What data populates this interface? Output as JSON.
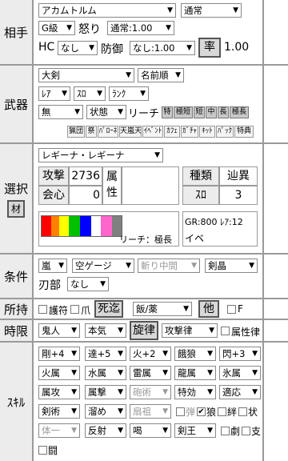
{
  "aite": {
    "label": "相手",
    "monster": "アカムトルム",
    "mode": "通常",
    "rank": "G級",
    "ikari_label": "怒り",
    "ikari_value": "通常:1.00",
    "hc_label": "HC",
    "hc_value": "なし",
    "bougyo_label": "防御",
    "bougyo_value": "なし:1.00",
    "ritsu_button": "率",
    "ritsu_value": "1.00"
  },
  "buki": {
    "label": "武器",
    "type": "大剣",
    "sort": "名前順",
    "rarity": "ﾚｱ",
    "slot": "ｽﾛ",
    "rank": "ﾗﾝｸ",
    "attr": "無",
    "state": "状態",
    "reach_label": "リーチ",
    "reach_chips": [
      "特",
      "極短",
      "短",
      "中",
      "長",
      "極長"
    ],
    "filter_chips": [
      "猟団",
      "祭",
      "ﾊﾟﾛｰﾈ",
      "天嵐天",
      "ｲﾍﾞﾝﾄ",
      "ｶﾌｪ",
      "ｶﾞﾁｬ",
      "ｷｯﾄ",
      "ﾊﾟｯｸ",
      "特典"
    ]
  },
  "sentaku": {
    "label": "選択",
    "mat_button": "材",
    "weapon": "レギーナ・レギーナ",
    "attack_label": "攻撃",
    "attack_value": "2736",
    "crit_label": "会心",
    "crit_value": "0",
    "element_label": "属性",
    "kind_label": "種類",
    "kind_value": "辿異",
    "slot_label": "ｽﾛ",
    "slot_value": "3",
    "reach_text": "リーチ：極長",
    "gr_text": "GR:800 ﾚｱ:12",
    "event_text": "イベ",
    "sharpness_colors": [
      "#ff0000",
      "#ff8000",
      "#ffff00",
      "#00c000",
      "#0000ff",
      "#ffffff",
      "#ff66cc",
      "#808080"
    ]
  },
  "jouken": {
    "label": "条件",
    "weather": "嵐",
    "gauge": "空ゲージ",
    "slash": "斬り中間",
    "sword": "剣晶",
    "blade_label": "刃部",
    "blade_value": "なし"
  },
  "shoji": {
    "label": "所持",
    "goshiki": "護符",
    "tsume": "爪",
    "shikitou": "死迄",
    "food": "飯/薬",
    "other_button": "他",
    "f_label": "F"
  },
  "jigen": {
    "label": "時限",
    "oni": "鬼人",
    "honki": "本気",
    "senritsu": "旋律",
    "kougeki": "攻撃律",
    "zokusei": "属性律"
  },
  "skill": {
    "label": "ｽｷﾙ",
    "rows": [
      [
        "剛+4",
        "達+5",
        "火+2",
        "餓狼",
        "閃+3"
      ],
      [
        "火属",
        "水属",
        "雷属",
        "龍属",
        "氷属"
      ],
      [
        "属攻",
        "属撃",
        "砲術",
        "特効",
        "適応"
      ],
      [
        "剣術",
        "溜め",
        "扇祖"
      ],
      [
        "体一",
        "反射",
        "喝",
        "剣王"
      ]
    ],
    "disabled": [
      "砲術",
      "扇祖",
      "体一"
    ],
    "check_row4": [
      "弾",
      "狼",
      "絆",
      "状"
    ],
    "check_row5": [
      "劇",
      "支"
    ],
    "check_row6": [
      "闘"
    ]
  }
}
